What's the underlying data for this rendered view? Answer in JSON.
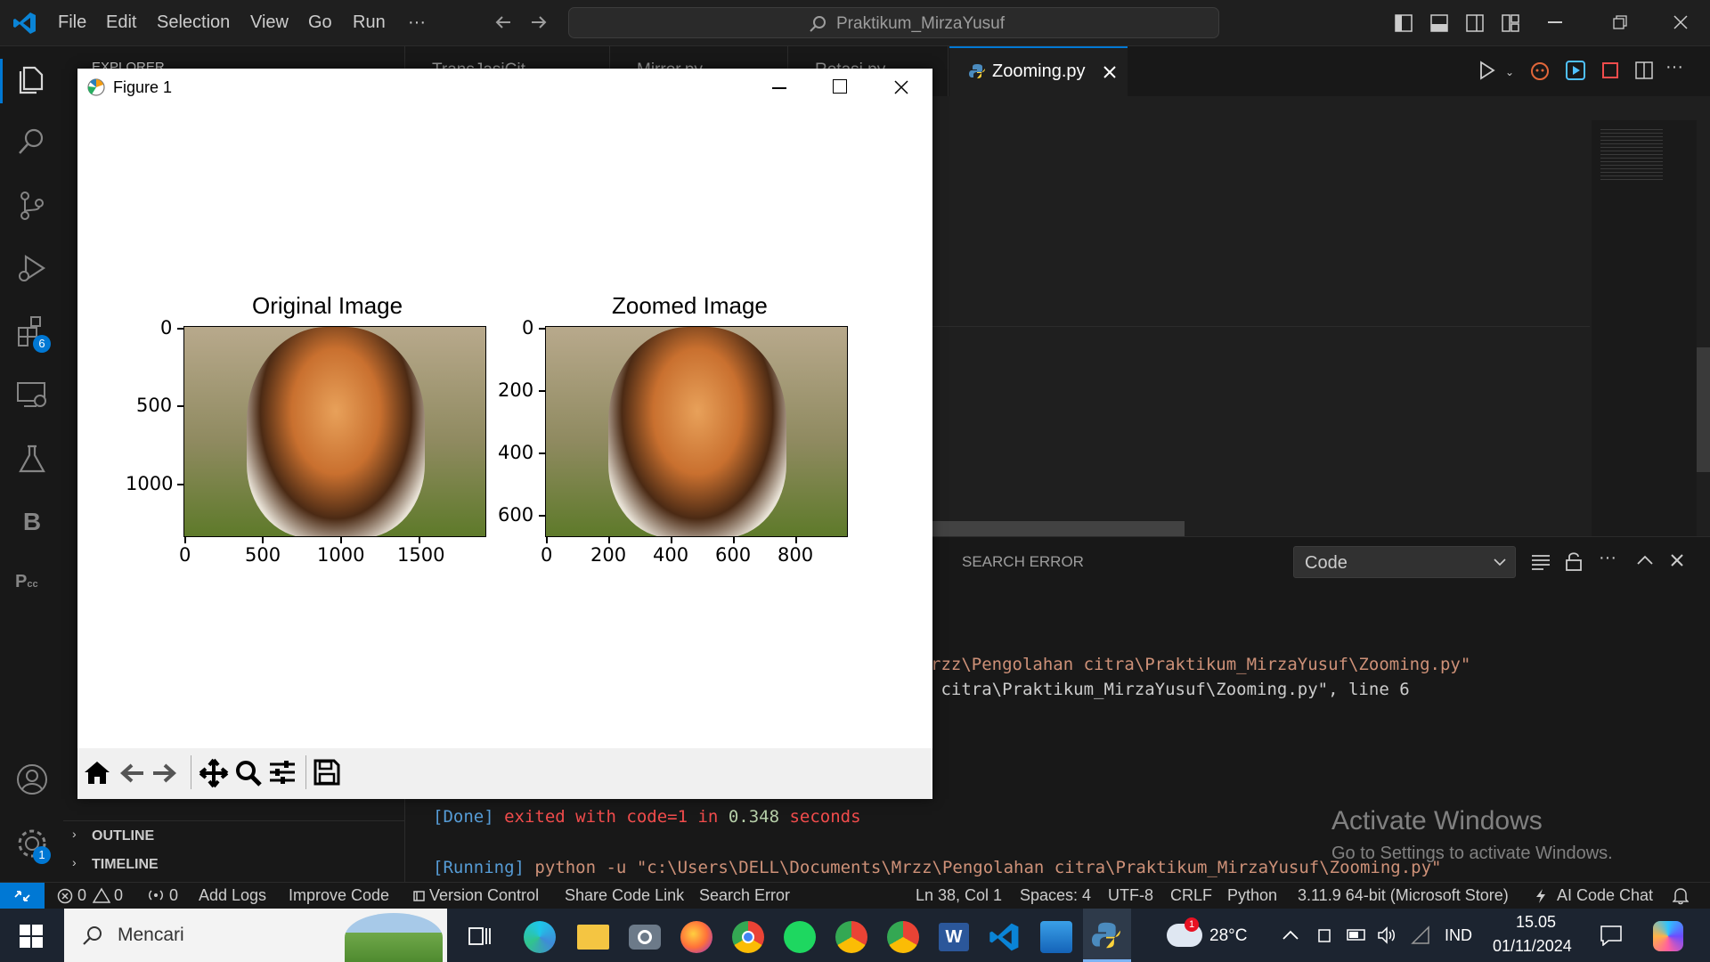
{
  "titlebar": {
    "menu": [
      "File",
      "Edit",
      "Selection",
      "View",
      "Go",
      "Run",
      "···"
    ],
    "search_text": "Praktikum_MirzaYusuf"
  },
  "activity": {
    "extensions_badge": "6",
    "settings_badge": "1"
  },
  "sidebar": {
    "header": "EXPLORER",
    "sections": [
      "OUTLINE",
      "TIMELINE"
    ]
  },
  "editor": {
    "tabs": [
      "TransJasiCit...",
      "Mirror.py",
      "Rotasi.py"
    ],
    "active_tab": "Zooming.py"
  },
  "panel": {
    "tab_label": "SEARCH ERROR",
    "dropdown_value": "Code",
    "lines": [
      {
        "text": "rzz\\Pengolahan citra\\Praktikum_MirzaYusuf\\Zooming.py\"",
        "color": "#ce9178"
      },
      {
        "text": " citra\\Praktikum_MirzaYusuf\\Zooming.py\", line 6",
        "color": "#cccccc"
      }
    ],
    "done": {
      "tag": "[Done]",
      "text": "exited with",
      "code": "code=1",
      "in": "in",
      "time": "0.348",
      "unit": "seconds"
    },
    "running": {
      "tag": "[Running]",
      "cmd": "python -u",
      "path": "\"c:\\Users\\DELL\\Documents\\Mrzz\\Pengolahan citra\\Praktikum_MirzaYusuf\\Zooming.py\""
    },
    "watermark_title": "Activate Windows",
    "watermark_sub": "Go to Settings to activate Windows."
  },
  "statusbar": {
    "errors": "0",
    "warnings": "0",
    "ports": "0",
    "items": [
      "Add Logs",
      "Improve Code",
      "Version Control",
      "Share Code Link",
      "Search Error"
    ],
    "cursor": "Ln 38, Col 1",
    "spaces": "Spaces: 4",
    "encoding": "UTF-8",
    "eol": "CRLF",
    "language": "Python",
    "interpreter": "3.11.9 64-bit (Microsoft Store)",
    "ai_chat": "AI Code Chat"
  },
  "taskbar": {
    "search_placeholder": "Mencari",
    "weather": "28°C",
    "weather_badge": "1",
    "lang": "IND",
    "time": "15.05",
    "date": "01/11/2024"
  },
  "figure": {
    "window_title": "Figure 1",
    "left_title": "Original Image",
    "right_title": "Zoomed Image",
    "left_yticks": [
      "0",
      "500",
      "1000"
    ],
    "left_xticks": [
      "0",
      "500",
      "1000",
      "1500"
    ],
    "right_yticks": [
      "0",
      "200",
      "400",
      "600"
    ],
    "right_xticks": [
      "0",
      "200",
      "400",
      "600",
      "800"
    ]
  }
}
